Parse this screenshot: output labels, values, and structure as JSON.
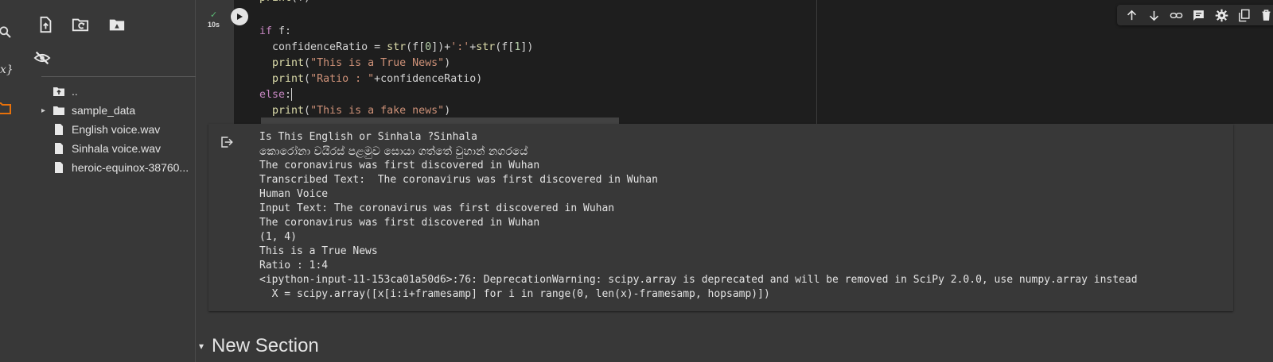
{
  "rail": {
    "icons": [
      "search-icon",
      "variables-icon",
      "folder-icon"
    ],
    "variables_label": "x}"
  },
  "sidebar": {
    "toolbar_icons": [
      "upload-file-icon",
      "refresh-folder-icon",
      "mount-drive-icon",
      "hide-files-icon"
    ],
    "tree": [
      {
        "label": "..",
        "icon": "folder-up-icon"
      },
      {
        "label": "sample_data",
        "icon": "folder-icon",
        "chevron": "▸"
      },
      {
        "label": "English voice.wav",
        "icon": "file-icon"
      },
      {
        "label": "Sinhala voice.wav",
        "icon": "file-icon"
      },
      {
        "label": "heroic-equinox-38760...",
        "icon": "file-icon"
      }
    ]
  },
  "cell": {
    "exec_check": "✓",
    "exec_time": "10s",
    "toolbar_icons": [
      "move-up-icon",
      "move-down-icon",
      "link-icon",
      "comment-icon",
      "settings-icon",
      "mirror-cell-icon",
      "delete-icon",
      "more-icon"
    ],
    "code": [
      "print(f)",
      "",
      "if f:",
      "  confidenceRatio = str(f[0])+':'+str(f[1])",
      "  print(\"This is a True News\")",
      "  print(\"Ratio : \"+confidenceRatio)",
      "else:",
      "  print(\"This is a fake news\")"
    ]
  },
  "output": {
    "lines": [
      "Is This English or Sinhala ?Sinhala",
      "කොරෝනා වයිරස් පළමුව සොයා ගත්තේ වුහාන් නගරයේ",
      "The coronavirus was first discovered in Wuhan",
      "Transcribed Text:  The coronavirus was first discovered in Wuhan",
      "Human Voice",
      "Input Text: The coronavirus was first discovered in Wuhan",
      "The coronavirus was first discovered in Wuhan",
      "(1, 4)",
      "This is a True News",
      "Ratio : 1:4",
      "<ipython-input-11-153ca01a50d6>:76: DeprecationWarning: scipy.array is deprecated and will be removed in SciPy 2.0.0, use numpy.array instead",
      "  X = scipy.array([x[i:i+framesamp] for i in range(0, len(x)-framesamp, hopsamp)])"
    ]
  },
  "section": {
    "chevron": "▾",
    "title": "New Section"
  },
  "colors": {
    "background": "#383838",
    "code_background": "#1e1e1e",
    "keyword": "#c586c0",
    "function": "#dcdcaa",
    "string": "#ce9178",
    "number": "#b5cea8",
    "success": "#5bb974",
    "folder_accent": "#e8710a"
  }
}
